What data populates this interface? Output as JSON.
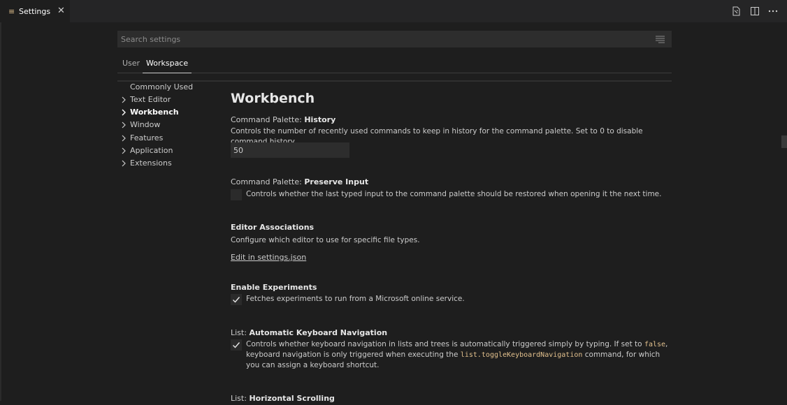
{
  "tab": {
    "icon": "settings-lines-icon",
    "label": "Settings",
    "close": "✕"
  },
  "actions": [
    "open-settings-json-icon",
    "split-editor-icon",
    "more-actions-icon"
  ],
  "search": {
    "placeholder": "Search settings",
    "value": ""
  },
  "scopes": [
    {
      "label": "User"
    },
    {
      "label": "Workspace",
      "active": true
    }
  ],
  "toc": [
    {
      "label": "Commonly Used",
      "expandable": false
    },
    {
      "label": "Text Editor",
      "expandable": true
    },
    {
      "label": "Workbench",
      "expandable": true,
      "active": true
    },
    {
      "label": "Window",
      "expandable": true
    },
    {
      "label": "Features",
      "expandable": true
    },
    {
      "label": "Application",
      "expandable": true
    },
    {
      "label": "Extensions",
      "expandable": true
    }
  ],
  "group_title": "Workbench",
  "settings": {
    "history": {
      "category": "Command Palette: ",
      "name": "History",
      "description": "Controls the number of recently used commands to keep in history for the command palette. Set to 0 to disable command history.",
      "value": "50"
    },
    "preserve": {
      "category": "Command Palette: ",
      "name": "Preserve Input",
      "description": "Controls whether the last typed input to the command palette should be restored when opening it the next time.",
      "checked": false
    },
    "editor_assoc": {
      "name": "Editor Associations",
      "description": "Configure which editor to use for specific file types.",
      "link": "Edit in settings.json"
    },
    "experiments": {
      "name": "Enable Experiments",
      "description": "Fetches experiments to run from a Microsoft online service.",
      "checked": true
    },
    "keyboard_nav": {
      "category": "List: ",
      "name": "Automatic Keyboard Navigation",
      "desc_1": "Controls whether keyboard navigation in lists and trees is automatically triggered simply by typing. If set to ",
      "code_1": "false",
      "desc_2": ", keyboard navigation is only triggered when executing the ",
      "code_2": "list.toggleKeyboardNavigation",
      "desc_3": " command, for which you can assign a keyboard shortcut.",
      "checked": true
    },
    "horizontal": {
      "category": "List: ",
      "name": "Horizontal Scrolling"
    }
  }
}
